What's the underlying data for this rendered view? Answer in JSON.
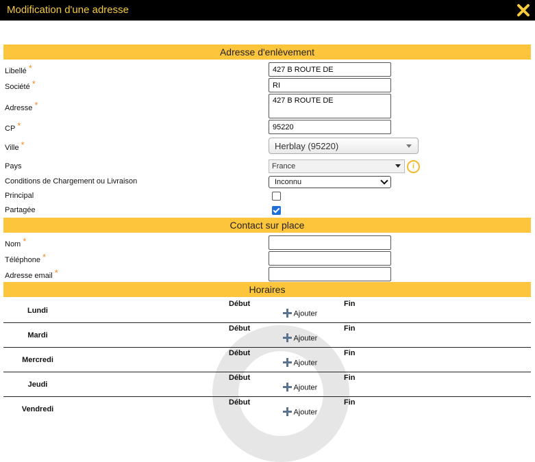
{
  "window": {
    "title": "Modification d'une adresse",
    "close_icon": "close-icon"
  },
  "sections": {
    "pickup": "Adresse d'enlèvement",
    "contact": "Contact sur place",
    "hours": "Horaires"
  },
  "required_mark": "*",
  "fields": {
    "libelle": {
      "label": "Libellé",
      "value": "427 B ROUTE DE"
    },
    "societe": {
      "label": "Société",
      "value": "RI"
    },
    "adresse": {
      "label": "Adresse",
      "value": "427 B ROUTE DE"
    },
    "cp": {
      "label": "CP",
      "value": "95220"
    },
    "ville": {
      "label": "Ville",
      "value": "Herblay (95220)"
    },
    "pays": {
      "label": "Pays",
      "value": "France"
    },
    "conditions": {
      "label": "Conditions de Chargement ou Livraison",
      "value": "Inconnu"
    },
    "principal": {
      "label": "Principal",
      "checked": false
    },
    "partagee": {
      "label": "Partagée",
      "checked": true
    }
  },
  "contact": {
    "nom": {
      "label": "Nom",
      "value": ""
    },
    "telephone": {
      "label": "Téléphone",
      "value": ""
    },
    "email": {
      "label": "Adresse email",
      "value": ""
    }
  },
  "hours": {
    "start_label": "Début",
    "end_label": "Fin",
    "add_label": "Ajouter",
    "days": [
      "Lundi",
      "Mardi",
      "Mercredi",
      "Jeudi",
      "Vendredi"
    ]
  },
  "colors": {
    "accent": "#fdc53b",
    "title": "#f7c93d",
    "required": "#f08a24"
  }
}
